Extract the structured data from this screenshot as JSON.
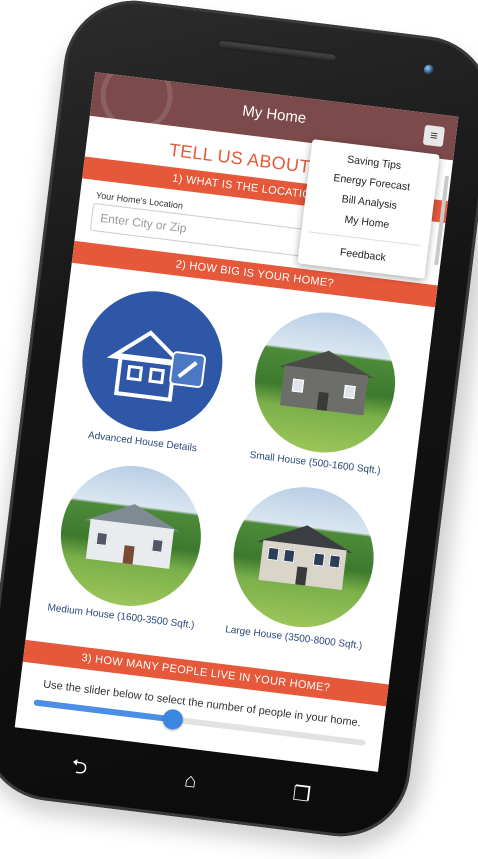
{
  "app_bar": {
    "title": "My Home",
    "menu_icon": "menu-icon"
  },
  "menu": {
    "items": [
      "Saving Tips",
      "Energy Forecast",
      "Bill Analysis",
      "My Home"
    ],
    "feedback": "Feedback"
  },
  "main": {
    "heading": "TELL US ABOUT YOUR",
    "section1": "1) WHAT IS THE LOCATION OF YO",
    "location_label": "Your Home's Location",
    "location_placeholder": "Enter City or Zip",
    "section2": "2) HOW BIG IS YOUR HOME?",
    "houses": [
      {
        "label": "Advanced House Details"
      },
      {
        "label": "Small House (500-1600 Sqft.)"
      },
      {
        "label": "Medium House (1600-3500 Sqft.)"
      },
      {
        "label": "Large House (3500-8000 Sqft.)"
      }
    ],
    "section3": "3) HOW MANY PEOPLE LIVE IN YOUR HOME?",
    "slider_instruction": "Use the slider below to select the number of people in your home.",
    "slider_value_fraction": 0.42
  },
  "nav": {
    "back_icon": "back-icon",
    "home_icon": "home-icon",
    "recents_icon": "recents-icon"
  },
  "colors": {
    "accent": "#e6583a",
    "app_bar": "#7c4a4b",
    "slider": "#3b86e0"
  }
}
